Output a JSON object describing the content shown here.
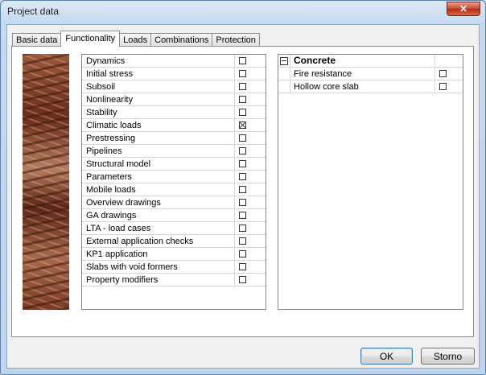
{
  "window": {
    "title": "Project data",
    "close_glyph": "✕"
  },
  "tabs": [
    {
      "label": "Basic data",
      "active": false
    },
    {
      "label": "Functionality",
      "active": true
    },
    {
      "label": "Loads",
      "active": false
    },
    {
      "label": "Combinations",
      "active": false
    },
    {
      "label": "Protection",
      "active": false
    }
  ],
  "functionality_list": [
    {
      "label": "Dynamics",
      "checked": false
    },
    {
      "label": "Initial stress",
      "checked": false
    },
    {
      "label": "Subsoil",
      "checked": false
    },
    {
      "label": "Nonlinearity",
      "checked": false
    },
    {
      "label": "Stability",
      "checked": false
    },
    {
      "label": "Climatic loads",
      "checked": true
    },
    {
      "label": "Prestressing",
      "checked": false
    },
    {
      "label": "Pipelines",
      "checked": false
    },
    {
      "label": "Structural model",
      "checked": false
    },
    {
      "label": "Parameters",
      "checked": false
    },
    {
      "label": "Mobile loads",
      "checked": false
    },
    {
      "label": "Overview drawings",
      "checked": false
    },
    {
      "label": "GA drawings",
      "checked": false
    },
    {
      "label": "LTA - load cases",
      "checked": false
    },
    {
      "label": "External application checks",
      "checked": false
    },
    {
      "label": "KP1 application",
      "checked": false
    },
    {
      "label": "Slabs with void formers",
      "checked": false
    },
    {
      "label": "Property modifiers",
      "checked": false
    }
  ],
  "tree": {
    "group": "Concrete",
    "expanded": true,
    "children": [
      {
        "label": "Fire resistance",
        "checked": false
      },
      {
        "label": "Hollow core slab",
        "checked": false
      }
    ]
  },
  "buttons": {
    "ok": "OK",
    "cancel": "Storno"
  },
  "icons": {
    "close": "close-icon",
    "checkbox": "checkbox-icon",
    "expander": "collapse-minus-icon",
    "image": "material-texture-image"
  }
}
